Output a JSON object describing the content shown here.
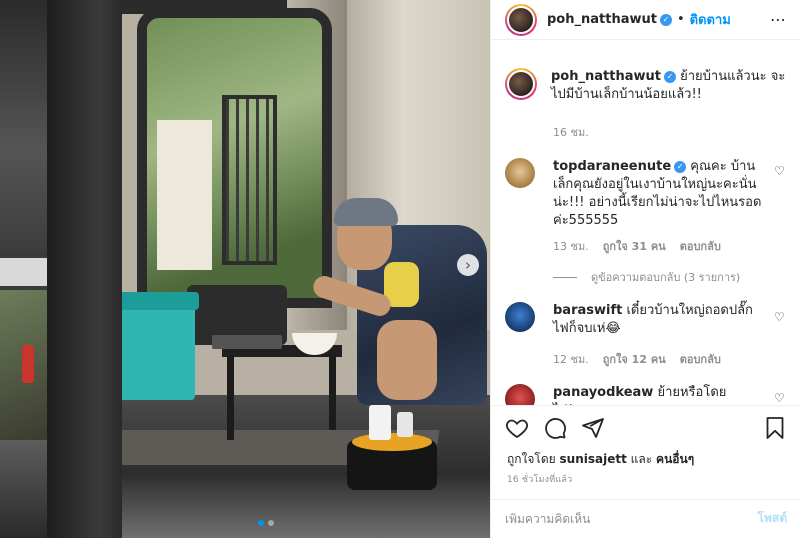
{
  "post": {
    "username": "poh_natthawut",
    "follow_label": "ติดตาม",
    "more_icon": "⋯",
    "caption": "ย้ายบ้านแล้วนะ จะไปมีบ้านเล็กบ้านน้อยแล้ว!!",
    "timestamp": "16 ชม."
  },
  "comments": [
    {
      "username": "topdaraneenute",
      "text": "คุณคะ บ้านเล็กคุณยังอยู่ในเงาบ้านใหญ่นะคะนั่นน่ะ!!! อย่างนี้เรียกไม่น่าจะไปไหนรอดค่ะ555555",
      "time": "13 ชม.",
      "likes": "ถูกใจ 31 คน",
      "reply": "ตอบกลับ",
      "view_replies": "ดูข้อความตอบกลับ (3 รายการ)"
    },
    {
      "username": "baraswift",
      "text": "เดี๋ยวบ้านใหญ่ถอดปลั๊กไฟก็จบเห่😂",
      "time": "12 ชม.",
      "likes": "ถูกใจ 12 คน",
      "reply": "ตอบกลับ"
    },
    {
      "username": "panayodkeaw",
      "text": "ย้ายหรือโดยไล่(บอก"
    }
  ],
  "likes_line": {
    "prefix": "ถูกใจโดย",
    "user": "sunisajett",
    "conj": "และ",
    "others": "คนอื่นๆ"
  },
  "time_ago": "16 ชั่วโมงที่แล้ว",
  "comment_box": {
    "placeholder": "เพิ่มความคิดเห็น",
    "post_label": "โพสต์"
  },
  "carousel": {
    "next_icon": "›",
    "active_index": 0,
    "count": 2
  },
  "colors": {
    "accent": "#0095f6",
    "verified": "#3897f0"
  }
}
